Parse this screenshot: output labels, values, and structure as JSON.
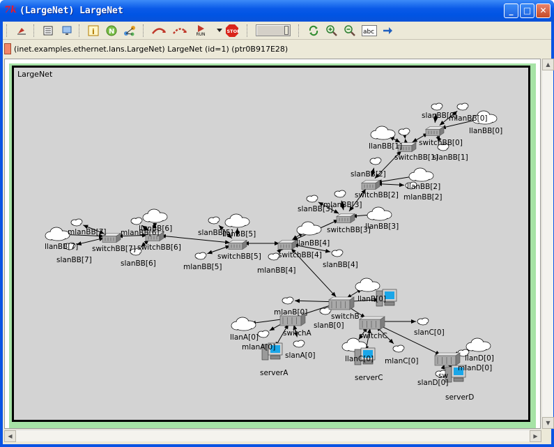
{
  "window": {
    "logo": "7k",
    "title": "(LargeNet) LargeNet",
    "minimize": "_",
    "maximize": "□",
    "close": "✕"
  },
  "toolbar": {
    "icons": [
      "back-icon",
      "list-icon",
      "monitor-icon",
      "info-icon",
      "n-icon",
      "graph-icon",
      "step-icon",
      "run-icon",
      "run-fast-icon",
      "stop-icon",
      "refresh-icon",
      "zoom-in-icon",
      "zoom-out-icon",
      "abc-icon",
      "arrow-icon"
    ],
    "run_label": "RUN",
    "stop_label": "STOP",
    "abc_label": "abc"
  },
  "infobar": {
    "text": "(inet.examples.ethernet.lans.LargeNet) LargeNet  (id=1)  (ptr0B917E28)"
  },
  "canvas": {
    "title": "LargeNet"
  },
  "network": {
    "labels": {
      "slanBB0": "slanBB[0]",
      "mlanBB0": "mlanBB[0]",
      "llanBB0": "llanBB[0]",
      "llanBB1": "llanBB[1]",
      "switchBB1": "switchBB[1]",
      "switchBB0": "switchBB[0]",
      "slanBB1": "slanBB[1]",
      "slanBB2": "slanBB[2]",
      "llanBB2": "llanBB[2]",
      "switchBB2": "switchBB[2]",
      "mlanBB2": "mlanBB[2]",
      "slanBB3": "slanBB[3]",
      "mlanBB3": "mlanBB[3]",
      "llanBB3": "llanBB[3]",
      "switchBB3": "switchBB[3]",
      "mlanBB7": "mlanBB[7]",
      "llanBB7": "llanBB[7]",
      "switchBB7": "switchBB[7]",
      "slanBB7": "slanBB[7]",
      "mlanBB6": "mlanBB[6]",
      "llanBB6": "llanBB[6]",
      "switchBB6": "switchBB[6]",
      "slanBB6": "slanBB[6]",
      "slanBB5": "slanBB[5]",
      "llanBB5": "llanBB[5]",
      "switchBB5": "switchBB[5]",
      "mlanBB5": "mlanBB[5]",
      "llanBB4": "llanBB[4]",
      "switchBB4": "switchBB[4]",
      "mlanBB4": "mlanBB[4]",
      "slanBB4": "slanBB[4]",
      "llanB": "llanB[0]",
      "switchB": "switchB",
      "slanB": "slanB[0]",
      "mlanB": "mlanB[0]",
      "llanA": "llanA[0]",
      "switchA": "switchA",
      "mlanA": "mlanA[0]",
      "slanA": "slanA[0]",
      "serverA": "serverA",
      "switchC": "switchC",
      "slanC": "slanC[0]",
      "llanC": "llanC[0]",
      "mlanC": "mlanC[0]",
      "serverC": "serverC",
      "llanD": "llanD[0]",
      "mlanD": "mlanD[0]",
      "slanD": "slanD[0]",
      "switchD": "sw",
      "serverD": "serverD"
    }
  }
}
